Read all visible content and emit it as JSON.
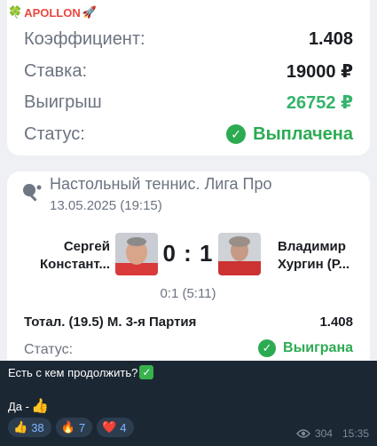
{
  "channel": {
    "name": "APOLLON",
    "clover": "🍀",
    "rocket": "🚀"
  },
  "bet": {
    "coef_label": "Коэффициент:",
    "coef_value": "1.408",
    "stake_label": "Ставка:",
    "stake_value": "19000 ₽",
    "win_label": "Выигрыш",
    "win_value": "26752 ₽",
    "status_label": "Статус:",
    "status_value": "Выплачена",
    "check": "✓"
  },
  "event": {
    "title": "Настольный теннис. Лига Про",
    "date": "13.05.2025 (19:15)",
    "player1": {
      "line1": "Сергей",
      "line2": "Констант..."
    },
    "player2": {
      "line1": "Владимир",
      "line2": "Хургин (Р..."
    },
    "score": "0 : 1",
    "sets": "0:1 (5:11)",
    "market": "Тотал. (19.5) М. 3-я Партия",
    "market_odds": "1.408",
    "status_label": "Статус:",
    "status_value": "Выиграна"
  },
  "caption": {
    "line1": "Есть с кем продолжить?",
    "line2": "Да - ",
    "thumb": "👍"
  },
  "reactions": [
    {
      "emoji": "👍",
      "count": "38"
    },
    {
      "emoji": "🔥",
      "count": "7"
    },
    {
      "emoji": "❤️",
      "count": "4"
    }
  ],
  "meta": {
    "views": "304",
    "time": "15:35"
  },
  "colors": {
    "accent_green": "#2cab52",
    "channel_red": "#e9473f",
    "bg_dark": "#1c2734"
  }
}
